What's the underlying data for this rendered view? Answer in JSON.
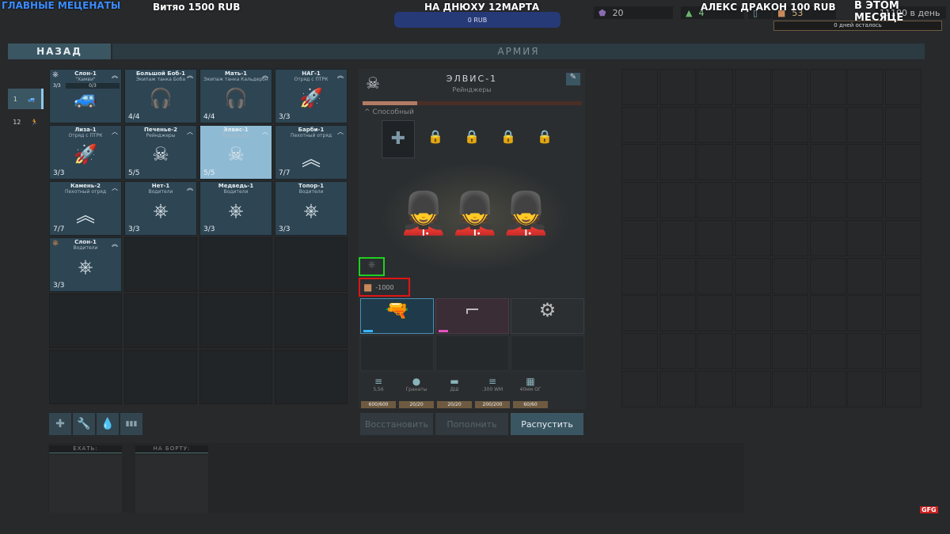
{
  "overlay": {
    "left": "ГЛАВНЫЕ МЕЦЕНАТЫ",
    "donor1": "Витяо 1500 RUB",
    "center": "НА ДНЮХУ 12МАРТА",
    "donor2": "АЛЕКС ДРАКОН 100 RUB",
    "right": "В ЭТОМ МЕСЯЦЕ",
    "goal": "0 RUB",
    "watermark": "GFG"
  },
  "resources": {
    "gems": "20",
    "people": "4",
    "fuel": "",
    "supplies": "53",
    "income": "11100 в день",
    "days_left": "0 дней осталось"
  },
  "header": {
    "back": "НАЗАД",
    "title": "АРМИЯ"
  },
  "side_tabs": [
    {
      "count": "1",
      "icon": "humvee-icon"
    },
    {
      "count": "12",
      "icon": "soldier-icon"
    }
  ],
  "units": [
    {
      "name": "Слон-1",
      "sub": "\"Хамви\"",
      "count": "3/3",
      "extra": "0/3",
      "icon": "🚙",
      "rank": "︽"
    },
    {
      "name": "Большой Боб-1",
      "sub": "Экипаж танка Боба",
      "count": "4/4",
      "icon": "🎧",
      "rank": "︽"
    },
    {
      "name": "Мать-1",
      "sub": "Экипаж танка Кальдерон",
      "count": "4/4",
      "icon": "🎧",
      "rank": "︽"
    },
    {
      "name": "НАГ-1",
      "sub": "Отряд с ПТРК",
      "count": "3/3",
      "icon": "🚀",
      "rank": "︽"
    },
    {
      "name": "Лиза-1",
      "sub": "Отряд с ПТРК",
      "count": "3/3",
      "icon": "🚀",
      "rank": "︿"
    },
    {
      "name": "Печенье-2",
      "sub": "Рейнджеры",
      "count": "5/5",
      "icon": "☠",
      "rank": "︿"
    },
    {
      "name": "Элвис-1",
      "sub": "Рейнджеры",
      "count": "5/5",
      "icon": "☠",
      "rank": "︿",
      "selected": true
    },
    {
      "name": "Барби-1",
      "sub": "Пехотный отряд",
      "count": "7/7",
      "icon": "︽",
      "rank": "︿"
    },
    {
      "name": "Камень-2",
      "sub": "Пехотный отряд",
      "count": "7/7",
      "icon": "︽",
      "rank": "︿"
    },
    {
      "name": "Нет-1",
      "sub": "Водители",
      "count": "3/3",
      "icon": "⎈",
      "rank": "︽"
    },
    {
      "name": "Медведь-1",
      "sub": "Водители",
      "count": "3/3",
      "icon": "⎈",
      "rank": ""
    },
    {
      "name": "Топор-1",
      "sub": "Водители",
      "count": "3/3",
      "icon": "⎈",
      "rank": ""
    },
    {
      "name": "Слон-1",
      "sub": "Водители",
      "count": "3/3",
      "icon": "⎈",
      "rank": "︽"
    }
  ],
  "toolbar": [
    "✚",
    "🔧",
    "💧",
    "▮▮▮"
  ],
  "detail": {
    "name": "ЭЛВИС-1",
    "type": "Рейнджеры",
    "xp_percent": 25,
    "trait": "Способный",
    "cost": "-1000",
    "ammo": [
      {
        "name": "5,56",
        "value": "600/600",
        "icon": "≡"
      },
      {
        "name": "Гранаты",
        "value": "20/20",
        "icon": "●"
      },
      {
        "name": "ДШ",
        "value": "20/20",
        "icon": "▬"
      },
      {
        "name": ".300 WM",
        "value": "200/200",
        "icon": "≡"
      },
      {
        "name": "40мм ОГ",
        "value": "60/60",
        "icon": "▦"
      }
    ],
    "buttons": {
      "restore": "Восстановить",
      "refill": "Пополнить",
      "disband": "Распустить"
    }
  },
  "transport": {
    "ride": "ЕХАТЬ:",
    "aboard": "НА БОРТУ:"
  },
  "colors": {
    "accent": "#2e4553",
    "selected": "#8fbad4",
    "disband": "#3b5663"
  }
}
